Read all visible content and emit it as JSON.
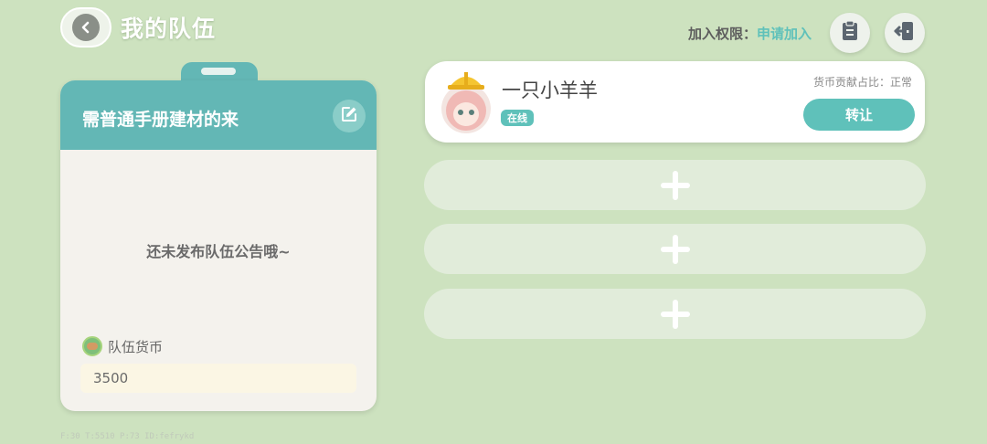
{
  "header": {
    "title": "我的队伍",
    "join_label": "加入权限：",
    "join_value": "申请加入"
  },
  "icons": {
    "back": "back-arrow-icon",
    "clipboard": "clipboard-icon",
    "exit": "exit-door-icon",
    "edit": "pencil-edit-icon",
    "coin": "team-coin-icon",
    "add": "plus-icon"
  },
  "notice": {
    "team_name": "需普通手册建材的来",
    "empty_text": "还未发布队伍公告哦~",
    "currency_label": "队伍货币",
    "currency_value": "3500"
  },
  "member": {
    "name": "一只小羊羊",
    "status": "在线",
    "contribution": "货币贡献占比：正常",
    "transfer_label": "转让"
  },
  "empty_slots": [
    {
      "label": "+"
    },
    {
      "label": "+"
    },
    {
      "label": "+"
    }
  ],
  "debug_line": "F:30  T:5510  P:73  ID:fefrykd",
  "colors": {
    "background": "#cde2bf",
    "accent": "#5fc1ba",
    "card_header": "#63b7b5"
  }
}
